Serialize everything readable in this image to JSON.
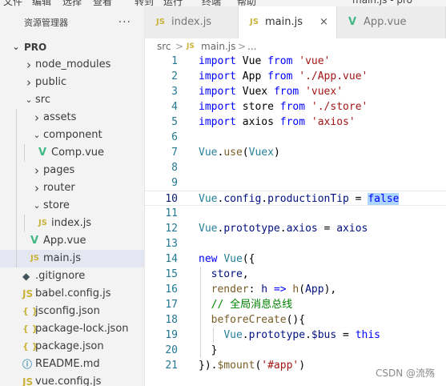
{
  "menubar": [
    "文件",
    "编辑",
    "选择",
    "查看",
    "转到",
    "运行",
    "终端",
    "帮助",
    "main.js - pro"
  ],
  "sidebar": {
    "title": "资源管理器",
    "more": "···",
    "root": "PRO",
    "items": [
      {
        "label": "node_modules",
        "kind": "folder",
        "expanded": false,
        "depth": 1
      },
      {
        "label": "public",
        "kind": "folder",
        "expanded": false,
        "depth": 1
      },
      {
        "label": "src",
        "kind": "folder",
        "expanded": true,
        "depth": 1
      },
      {
        "label": "assets",
        "kind": "folder",
        "expanded": false,
        "depth": 2
      },
      {
        "label": "component",
        "kind": "folder",
        "expanded": true,
        "depth": 2
      },
      {
        "label": "Comp.vue",
        "kind": "vue",
        "depth": 3
      },
      {
        "label": "pages",
        "kind": "folder",
        "expanded": false,
        "depth": 2
      },
      {
        "label": "router",
        "kind": "folder",
        "expanded": false,
        "depth": 2
      },
      {
        "label": "store",
        "kind": "folder",
        "expanded": true,
        "depth": 2
      },
      {
        "label": "index.js",
        "kind": "js",
        "depth": 3
      },
      {
        "label": "App.vue",
        "kind": "vue",
        "depth": 2
      },
      {
        "label": "main.js",
        "kind": "js",
        "depth": 2,
        "selected": true
      },
      {
        "label": ".gitignore",
        "kind": "git",
        "depth": 1
      },
      {
        "label": "babel.config.js",
        "kind": "babel",
        "depth": 1
      },
      {
        "label": "jsconfig.json",
        "kind": "json",
        "depth": 1
      },
      {
        "label": "package-lock.json",
        "kind": "json",
        "depth": 1
      },
      {
        "label": "package.json",
        "kind": "json",
        "depth": 1
      },
      {
        "label": "README.md",
        "kind": "info",
        "depth": 1
      },
      {
        "label": "vue.config.js",
        "kind": "babel",
        "depth": 1
      }
    ]
  },
  "tabs": [
    {
      "label": "index.js",
      "icon": "JS",
      "active": false
    },
    {
      "label": "main.js",
      "icon": "JS",
      "active": true,
      "close": "×"
    },
    {
      "label": "App.vue",
      "icon": "V",
      "active": false
    }
  ],
  "breadcrumb": {
    "folder": "src",
    "sep": ">",
    "icon": "JS",
    "file": "main.js",
    "tail": "..."
  },
  "editor": {
    "current_line": 10,
    "lines": [
      [
        [
          "kw",
          "import"
        ],
        [
          "plain",
          " Vue "
        ],
        [
          "kw",
          "from"
        ],
        [
          "plain",
          " "
        ],
        [
          "str",
          "'vue'"
        ]
      ],
      [
        [
          "kw",
          "import"
        ],
        [
          "plain",
          " App "
        ],
        [
          "kw",
          "from"
        ],
        [
          "plain",
          " "
        ],
        [
          "str",
          "'./App.vue'"
        ]
      ],
      [
        [
          "kw",
          "import"
        ],
        [
          "plain",
          " Vuex "
        ],
        [
          "kw",
          "from"
        ],
        [
          "plain",
          " "
        ],
        [
          "str",
          "'vuex'"
        ]
      ],
      [
        [
          "kw",
          "import"
        ],
        [
          "plain",
          " store "
        ],
        [
          "kw",
          "from"
        ],
        [
          "plain",
          " "
        ],
        [
          "str",
          "'./store'"
        ]
      ],
      [
        [
          "kw",
          "import"
        ],
        [
          "plain",
          " axios "
        ],
        [
          "kw",
          "from"
        ],
        [
          "plain",
          " "
        ],
        [
          "str",
          "'axios'"
        ]
      ],
      [],
      [
        [
          "type",
          "Vue"
        ],
        [
          "plain",
          "."
        ],
        [
          "fn",
          "use"
        ],
        [
          "plain",
          "("
        ],
        [
          "type",
          "Vuex"
        ],
        [
          "plain",
          ")"
        ]
      ],
      [],
      [],
      [
        [
          "type",
          "Vue"
        ],
        [
          "plain",
          "."
        ],
        [
          "prop",
          "config"
        ],
        [
          "plain",
          "."
        ],
        [
          "prop",
          "productionTip"
        ],
        [
          "plain",
          " = "
        ],
        [
          "kw",
          "false"
        ]
      ],
      [],
      [
        [
          "type",
          "Vue"
        ],
        [
          "plain",
          "."
        ],
        [
          "prop",
          "prototype"
        ],
        [
          "plain",
          "."
        ],
        [
          "prop",
          "axios"
        ],
        [
          "plain",
          " = "
        ],
        [
          "prop",
          "axios"
        ]
      ],
      [],
      [
        [
          "kw",
          "new"
        ],
        [
          "plain",
          " "
        ],
        [
          "type",
          "Vue"
        ],
        [
          "plain",
          "({"
        ]
      ],
      [
        [
          "plain",
          "  "
        ],
        [
          "prop",
          "store"
        ],
        [
          "plain",
          ","
        ]
      ],
      [
        [
          "plain",
          "  "
        ],
        [
          "fn",
          "render"
        ],
        [
          "plain",
          ": "
        ],
        [
          "prop",
          "h"
        ],
        [
          "plain",
          " "
        ],
        [
          "kw",
          "=>"
        ],
        [
          "plain",
          " "
        ],
        [
          "fn",
          "h"
        ],
        [
          "plain",
          "("
        ],
        [
          "prop",
          "App"
        ],
        [
          "plain",
          "),"
        ]
      ],
      [
        [
          "plain",
          "  "
        ],
        [
          "cmt",
          "// 全局消息总线"
        ]
      ],
      [
        [
          "plain",
          "  "
        ],
        [
          "fn",
          "beforeCreate"
        ],
        [
          "plain",
          "(){"
        ]
      ],
      [
        [
          "plain",
          "    "
        ],
        [
          "type",
          "Vue"
        ],
        [
          "plain",
          "."
        ],
        [
          "prop",
          "prototype"
        ],
        [
          "plain",
          "."
        ],
        [
          "prop",
          "$bus"
        ],
        [
          "plain",
          " = "
        ],
        [
          "kw",
          "this"
        ]
      ],
      [
        [
          "plain",
          "  }"
        ]
      ],
      [
        [
          "plain",
          "})."
        ],
        [
          "fn",
          "$mount"
        ],
        [
          "plain",
          "("
        ],
        [
          "str",
          "'#app'"
        ],
        [
          "plain",
          ")"
        ]
      ]
    ]
  },
  "watermark": "CSDN @流殇"
}
